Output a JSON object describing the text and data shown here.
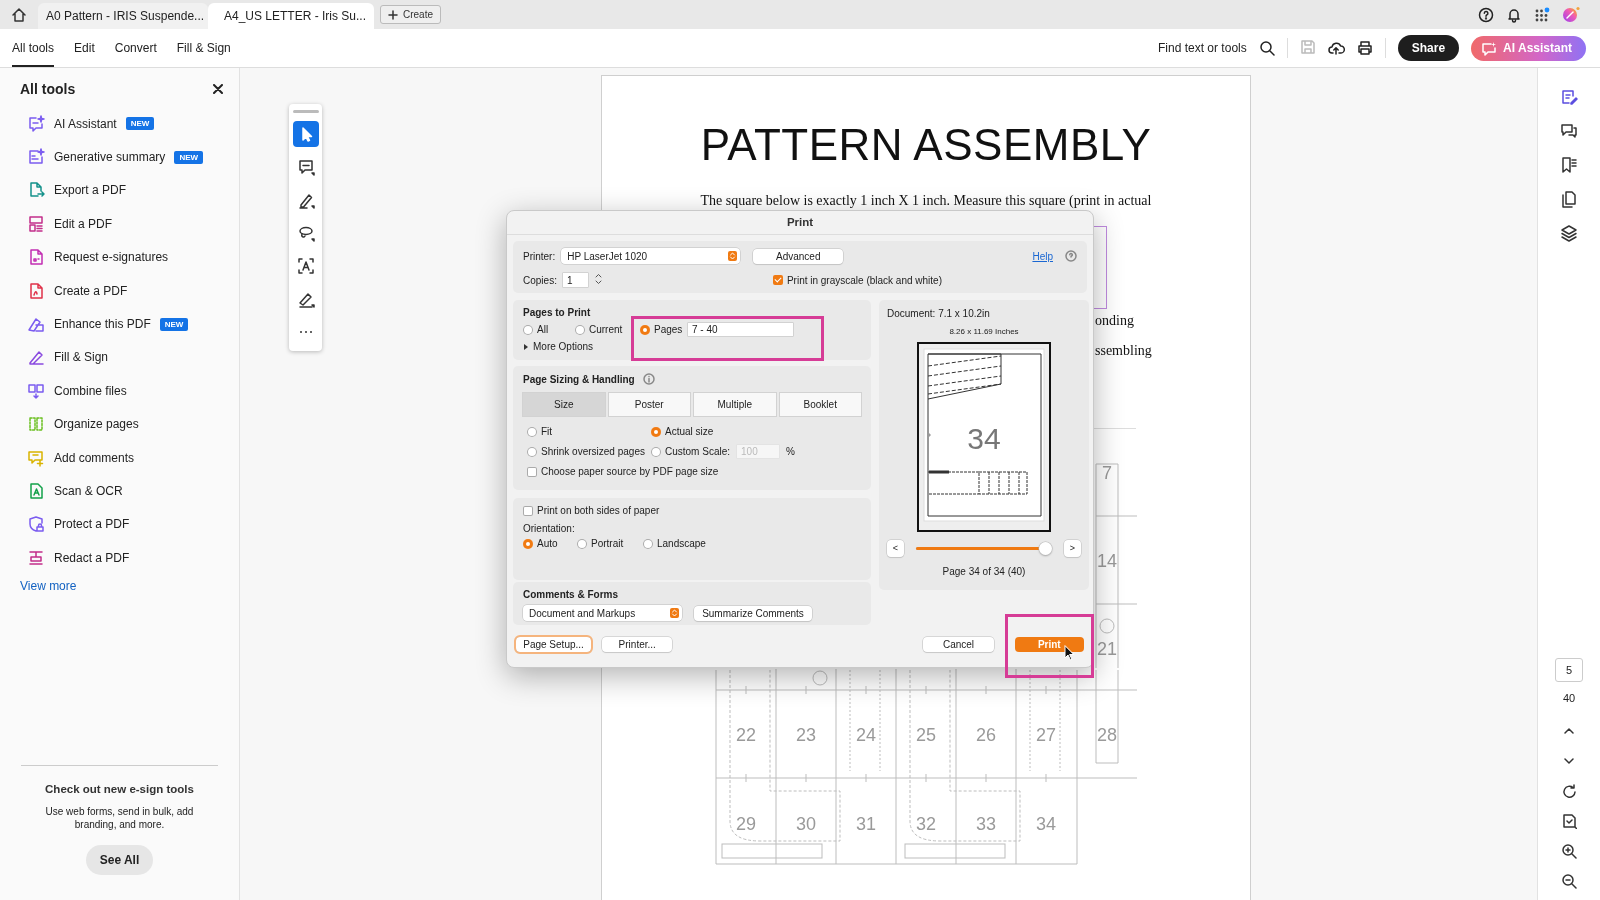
{
  "browser_tabs": [
    {
      "label": "A0 Pattern - IRIS Suspende...",
      "selected": false
    },
    {
      "label": "A4_US LETTER - Iris Su...",
      "selected": true
    }
  ],
  "create_button": "Create",
  "menu": [
    {
      "label": "All tools",
      "selected": true
    },
    {
      "label": "Edit",
      "selected": false
    },
    {
      "label": "Convert",
      "selected": false
    },
    {
      "label": "Fill & Sign",
      "selected": false
    }
  ],
  "search": "Find text or tools",
  "share_button": "Share",
  "ai_button": "AI Assistant",
  "tools_panel": {
    "title": "All tools",
    "items": [
      {
        "label": "AI Assistant",
        "badge": "NEW"
      },
      {
        "label": "Generative summary",
        "badge": "NEW"
      },
      {
        "label": "Export a PDF"
      },
      {
        "label": "Edit a PDF"
      },
      {
        "label": "Request e-signatures"
      },
      {
        "label": "Create a PDF"
      },
      {
        "label": "Enhance this PDF",
        "badge": "NEW"
      },
      {
        "label": "Fill & Sign"
      },
      {
        "label": "Combine files"
      },
      {
        "label": "Organize pages"
      },
      {
        "label": "Add comments"
      },
      {
        "label": "Scan & OCR"
      },
      {
        "label": "Protect a PDF"
      },
      {
        "label": "Redact a PDF"
      }
    ],
    "view_more": "View more",
    "promo": {
      "title": "Check out new e-sign tools",
      "text": "Use web forms, send in bulk, add branding, and more.",
      "button": "See All"
    }
  },
  "quick_tools": [
    {
      "kind": "select",
      "selected": true
    },
    {
      "kind": "comment",
      "selected": false
    },
    {
      "kind": "draw",
      "selected": false
    },
    {
      "kind": "lasso",
      "selected": false
    },
    {
      "kind": "text",
      "selected": false
    },
    {
      "kind": "sign",
      "selected": false
    },
    {
      "kind": "more",
      "selected": false
    }
  ],
  "document": {
    "title": "PATTERN ASSEMBLY",
    "paragraph": "The square below is exactly 1 inch X 1 inch. Measure this square (print in actual",
    "fragments": [
      "onding",
      "ssembling"
    ],
    "strip_numbers": [
      "7",
      "14",
      "21"
    ],
    "grid_numbers": [
      [
        "22",
        "23",
        "24",
        "25",
        "26",
        "27",
        "28"
      ],
      [
        "29",
        "30",
        "31",
        "32",
        "33",
        "34"
      ]
    ]
  },
  "print_dialog": {
    "title": "Print",
    "printer_label": "Printer:",
    "printer": "HP LaserJet 1020",
    "advanced": "Advanced",
    "help": "Help",
    "copies_label": "Copies:",
    "copies": "1",
    "grayscale": {
      "label": "Print in grayscale (black and white)",
      "checked": true
    },
    "pages_to_print": {
      "title": "Pages to Print",
      "options": [
        {
          "label": "All",
          "selected": false
        },
        {
          "label": "Current",
          "selected": false
        },
        {
          "label": "Pages",
          "selected": true
        }
      ],
      "range": "7 - 40",
      "more_options": "More Options"
    },
    "sizing": {
      "title": "Page Sizing & Handling",
      "modes": [
        {
          "label": "Size",
          "selected": true
        },
        {
          "label": "Poster",
          "selected": false
        },
        {
          "label": "Multiple",
          "selected": false
        },
        {
          "label": "Booklet",
          "selected": false
        }
      ],
      "options": [
        {
          "label": "Fit",
          "selected": false
        },
        {
          "label": "Actual size",
          "selected": true
        },
        {
          "label": "Shrink oversized pages",
          "selected": false
        },
        {
          "label": "Custom Scale:",
          "selected": false
        }
      ],
      "scale": "100",
      "scale_unit": "%",
      "paper_source": {
        "label": "Choose paper source by PDF page size",
        "checked": false
      }
    },
    "duplex": {
      "label": "Print on both sides of paper",
      "checked": false
    },
    "orientation": {
      "label": "Orientation:",
      "options": [
        {
          "label": "Auto",
          "selected": true
        },
        {
          "label": "Portrait",
          "selected": false
        },
        {
          "label": "Landscape",
          "selected": false
        }
      ]
    },
    "comments": {
      "title": "Comments & Forms",
      "value": "Document and Markups",
      "summarize": "Summarize Comments"
    },
    "preview": {
      "document": "Document: 7.1 x 10.2in",
      "paper": "8.26 x 11.69 Inches",
      "page_number": "34",
      "prev": "<",
      "next": ">",
      "level": 1,
      "page_label": "Page 34 of 34 (40)"
    },
    "buttons": [
      {
        "label": "Page Setup...",
        "kind": "secondary",
        "focused": true
      },
      {
        "label": "Printer...",
        "kind": "secondary",
        "focused": false
      },
      {
        "label": "Cancel",
        "kind": "secondary",
        "focused": false
      },
      {
        "label": "Print",
        "kind": "default",
        "focused": false
      }
    ]
  },
  "page_nav": {
    "current": "5",
    "total": "40"
  }
}
